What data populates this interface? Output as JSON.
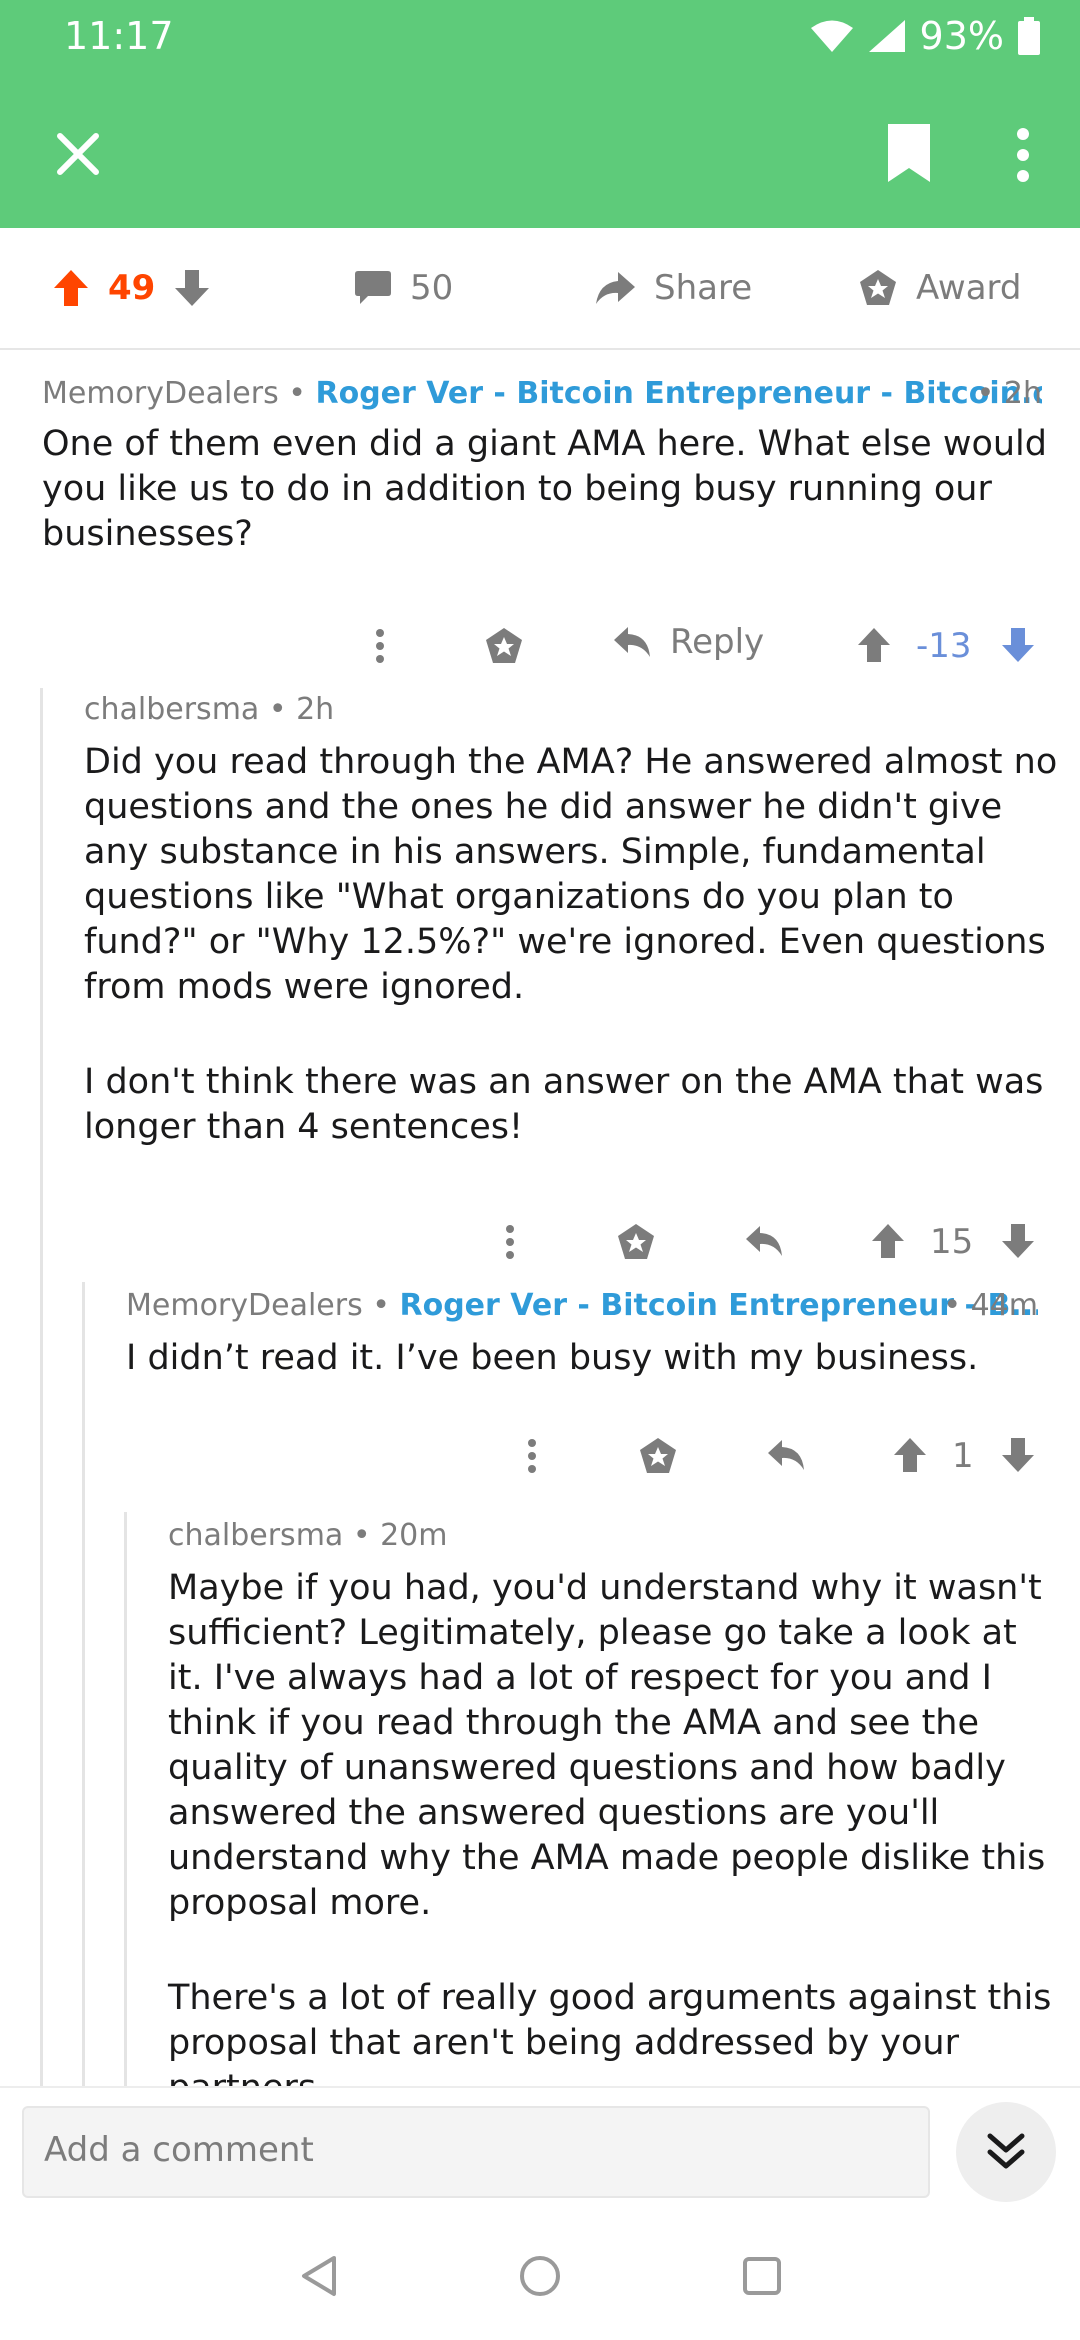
{
  "status_bar": {
    "time": "11:17",
    "battery": "93%"
  },
  "post_actions": {
    "score": "49",
    "comments": "50",
    "share_label": "Share",
    "award_label": "Award"
  },
  "comments": [
    {
      "author": "MemoryDealers",
      "flair": "Roger Ver - Bitcoin Entrepreneur - Bitcoin.c...",
      "age": "2h",
      "paragraphs": [
        "One of them even did a giant AMA here.  What else would you like us to do in addition to being busy running our businesses?"
      ],
      "reply_label": "Reply",
      "score": "-13"
    },
    {
      "author": "chalbersma",
      "age": "2h",
      "paragraphs": [
        "Did you read through the AMA? He answered almost no questions and the ones he did answer he didn't give any substance in his answers. Simple, fundamental questions like \"What organizations do you plan to fund?\" or \"Why 12.5%?\" we're ignored. Even questions from mods were ignored.",
        "I don't think there was an answer on the AMA that was longer than 4 sentences!"
      ],
      "score": "15"
    },
    {
      "author": "MemoryDealers",
      "flair": "Roger Ver - Bitcoin Entrepreneur - B...",
      "age": "44m",
      "paragraphs": [
        "I didn’t read it.  I’ve been busy with my business."
      ],
      "score": "1"
    },
    {
      "author": "chalbersma",
      "age": "20m",
      "paragraphs": [
        "Maybe if you had, you'd understand why it wasn't sufficient? Legitimately, please go take a look at it. I've always had a lot of respect for you and I think if you read through the AMA and see the quality of unanswered questions and how badly answered the answered questions are you'll understand why the AMA made people dislike this proposal more.",
        "There's a lot of really good arguments against this proposal that aren't being addressed by your partners."
      ]
    }
  ],
  "comment_box": {
    "placeholder": "Add a comment"
  },
  "icons": {
    "upvote": "arrow-up-icon",
    "downvote": "arrow-down-icon",
    "award": "award-icon",
    "reply": "reply-arrow-icon",
    "more": "vertical-dots-icon"
  },
  "colors": {
    "header": "#5ecb7a",
    "upvoted": "#ff4500",
    "downvoted": "#6a8fd9",
    "flair": "#2f9bd9"
  }
}
